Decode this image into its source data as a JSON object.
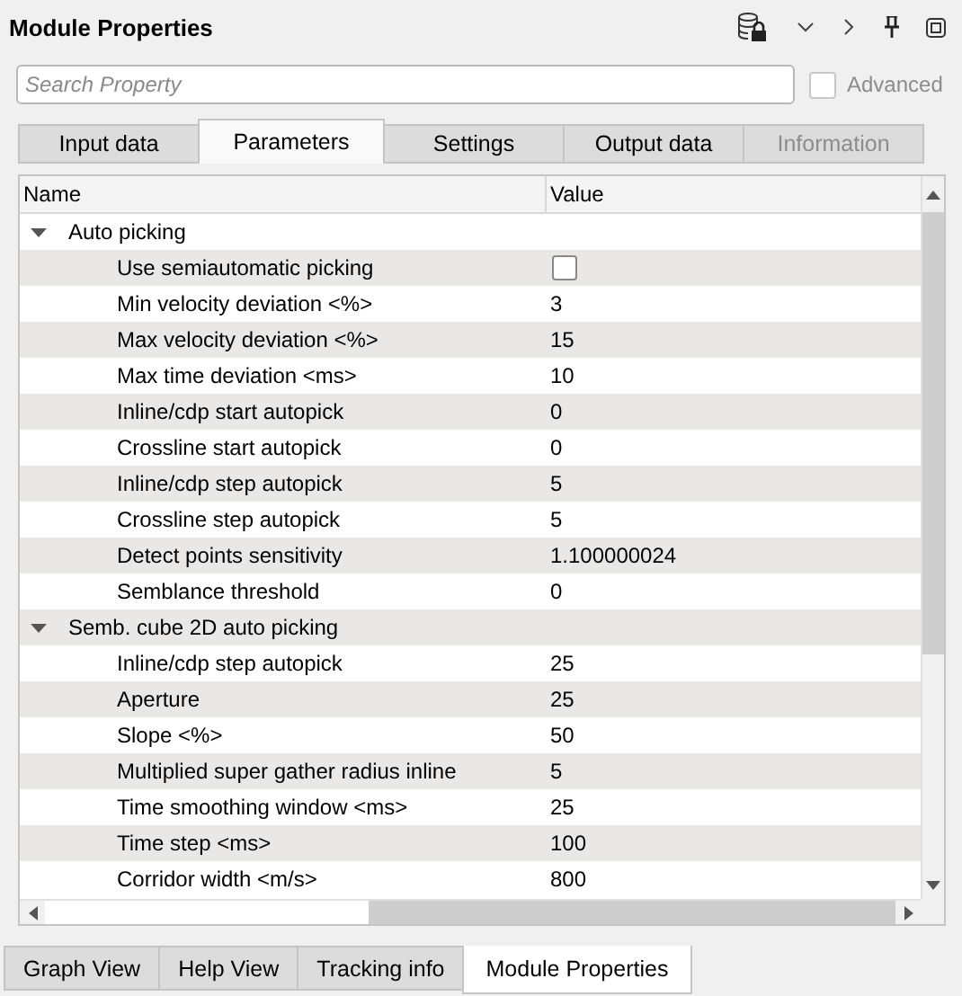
{
  "panel": {
    "title": "Module Properties"
  },
  "search": {
    "placeholder": "Search Property"
  },
  "advanced": {
    "label": "Advanced",
    "checked": false,
    "disabled": true
  },
  "tabs": [
    {
      "label": "Input data",
      "selected": false,
      "disabled": false
    },
    {
      "label": "Parameters",
      "selected": true,
      "disabled": false
    },
    {
      "label": "Settings",
      "selected": false,
      "disabled": false
    },
    {
      "label": "Output data",
      "selected": false,
      "disabled": false
    },
    {
      "label": "Information",
      "selected": false,
      "disabled": true
    }
  ],
  "table": {
    "columns": [
      "Name",
      "Value"
    ],
    "groups": [
      {
        "name": "Auto picking",
        "expanded": true,
        "children": [
          {
            "name": "Use semiautomatic picking",
            "kind": "checkbox",
            "checked": false
          },
          {
            "name": "Min velocity deviation <%>",
            "kind": "text",
            "value": "3"
          },
          {
            "name": "Max velocity deviation <%>",
            "kind": "text",
            "value": "15"
          },
          {
            "name": "Max time deviation <ms>",
            "kind": "text",
            "value": "10"
          },
          {
            "name": "Inline/cdp start autopick",
            "kind": "text",
            "value": "0"
          },
          {
            "name": "Crossline start autopick",
            "kind": "text",
            "value": "0"
          },
          {
            "name": "Inline/cdp step autopick",
            "kind": "text",
            "value": "5"
          },
          {
            "name": "Crossline step autopick",
            "kind": "text",
            "value": "5"
          },
          {
            "name": "Detect points sensitivity",
            "kind": "text",
            "value": "1.100000024"
          },
          {
            "name": "Semblance threshold",
            "kind": "text",
            "value": "0"
          }
        ]
      },
      {
        "name": "Semb. cube 2D auto picking",
        "expanded": true,
        "children": [
          {
            "name": "Inline/cdp step autopick",
            "kind": "text",
            "value": "25"
          },
          {
            "name": "Aperture",
            "kind": "text",
            "value": "25"
          },
          {
            "name": "Slope <%>",
            "kind": "text",
            "value": "50"
          },
          {
            "name": "Multiplied super gather radius inline",
            "kind": "text",
            "value": "5"
          },
          {
            "name": "Time smoothing window <ms>",
            "kind": "text",
            "value": "25"
          },
          {
            "name": "Time step <ms>",
            "kind": "text",
            "value": "100"
          },
          {
            "name": "Corridor width <m/s>",
            "kind": "text",
            "value": "800"
          }
        ]
      }
    ]
  },
  "bottom_tabs": [
    {
      "label": "Graph View",
      "selected": false
    },
    {
      "label": "Help View",
      "selected": false
    },
    {
      "label": "Tracking info",
      "selected": false
    },
    {
      "label": "Module Properties",
      "selected": true
    }
  ]
}
